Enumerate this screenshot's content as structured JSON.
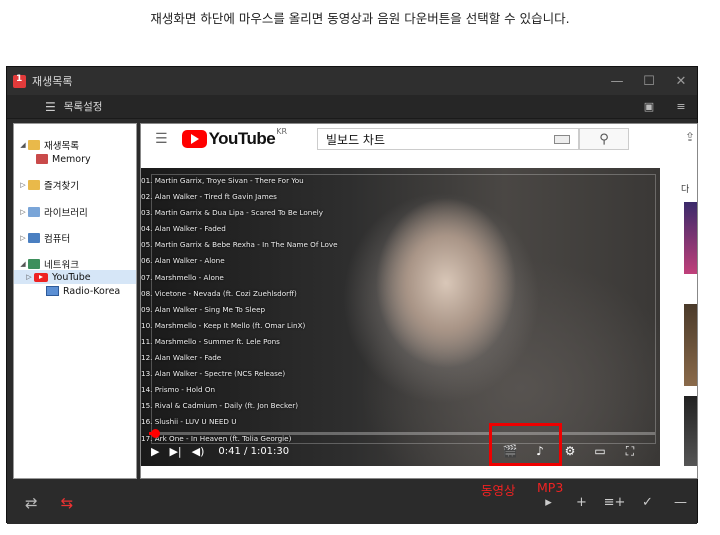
{
  "caption": "재생화면 하단에 마우스를 올리면 동영상과 음원 다운버튼을 선택할 수 있습니다.",
  "window": {
    "title": "재생목록",
    "controls": [
      "minimize-icon",
      "maximize-icon",
      "close-icon"
    ]
  },
  "toolbar": {
    "menu_label": "목록설정"
  },
  "tree": [
    {
      "label": "재생목록",
      "icon": "folder-icon"
    },
    {
      "label": "Memory",
      "icon": "memory-icon"
    },
    {
      "label": "즐겨찾기",
      "icon": "folder-icon"
    },
    {
      "label": "라이브러리",
      "icon": "library-icon"
    },
    {
      "label": "컴퓨터",
      "icon": "computer-icon"
    },
    {
      "label": "네트워크",
      "icon": "network-icon"
    },
    {
      "label": "YouTube",
      "icon": "youtube-icon"
    },
    {
      "label": "Radio-Korea",
      "icon": "radio-icon"
    }
  ],
  "browser": {
    "logo_text": "YouTube",
    "logo_region": "KR",
    "search_value": "빌보드 차트"
  },
  "video": {
    "tracks": [
      "01. Martin Garrix, Troye Sivan - There For You",
      "02. Alan Walker - Tired ft Gavin James",
      "03. Martin Garrix & Dua Lipa - Scared To Be Lonely",
      "04. Alan Walker - Faded",
      "05. Martin Garrix & Bebe Rexha - In The Name Of Love",
      "06. Alan Walker - Alone",
      "07. Marshmello - Alone",
      "08. Vicetone - Nevada (ft. Cozi Zuehlsdorff)",
      "09. Alan Walker - Sing Me To Sleep",
      "10. Marshmello - Keep It Mello (ft. Omar LinX)",
      "11. Marshmello - Summer ft. Lele Pons",
      "12. Alan Walker - Fade",
      "13. Alan Walker - Spectre (NCS Release)",
      "14. Prismo - Hold On",
      "15. Rival & Cadmium - Daily (ft. Jon Becker)",
      "16. Slushii - LUV U NEED U",
      "17. Ark One - In Heaven (ft. Tolia Georgie)"
    ],
    "time": "0:41 / 1:01:30",
    "progress": 0.011
  },
  "labels": {
    "video_download": "동영상",
    "mp3_download": "MP3"
  },
  "accent": "#e22222"
}
